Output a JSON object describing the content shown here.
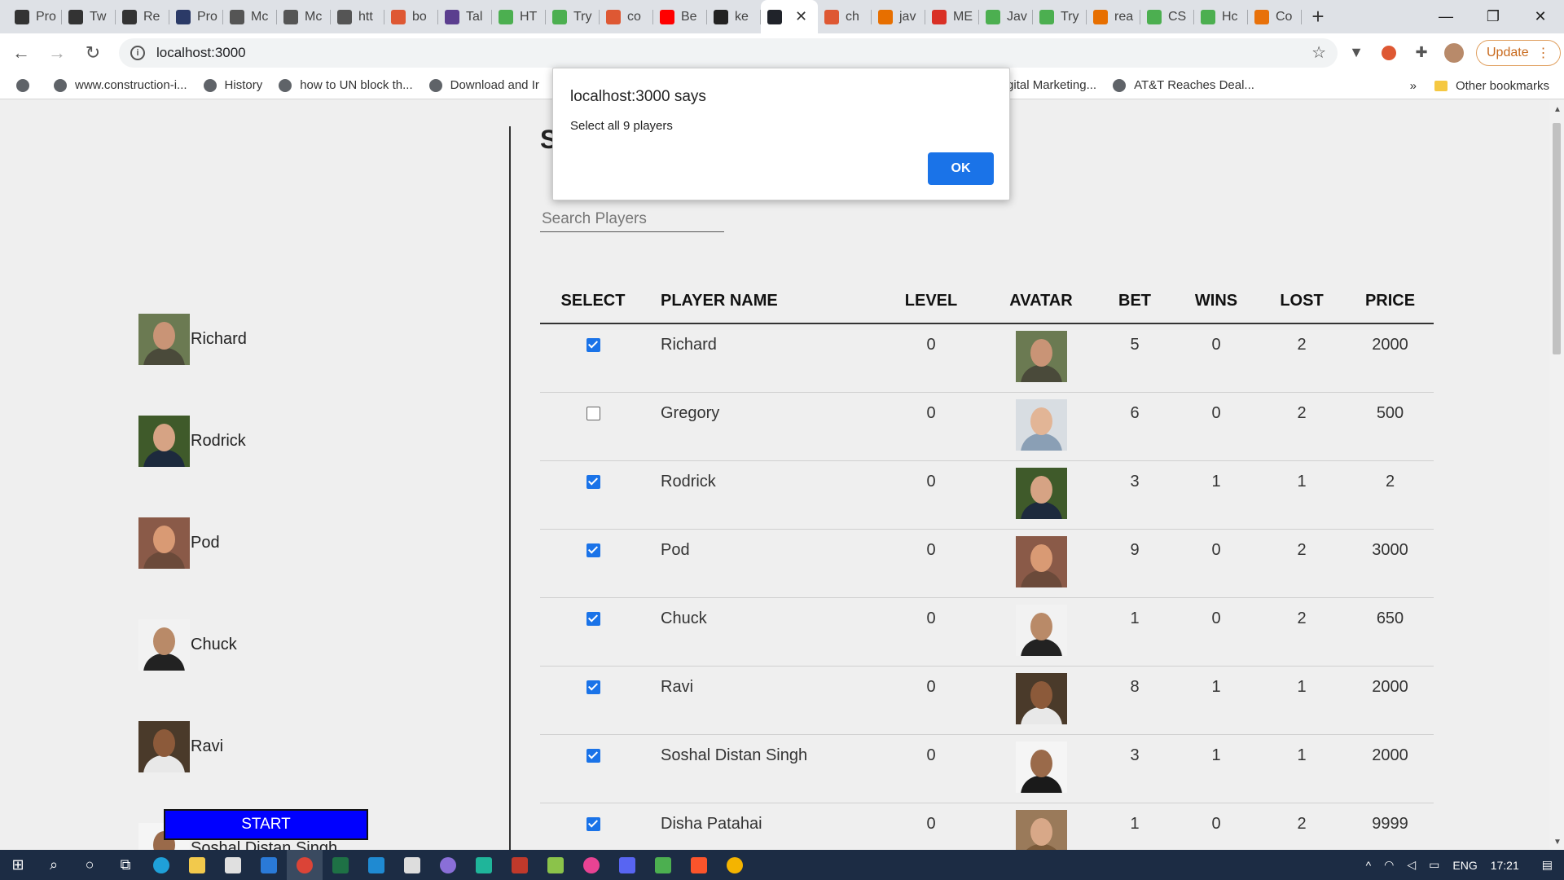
{
  "browser": {
    "tabs": [
      {
        "label": "Pro",
        "icon": "moon-icon",
        "color": "#333333"
      },
      {
        "label": "Tw",
        "icon": "moon-icon",
        "color": "#333333"
      },
      {
        "label": "Re",
        "icon": "moon-icon",
        "color": "#333333"
      },
      {
        "label": "Pro",
        "icon": "h-icon",
        "color": "#2b3a67"
      },
      {
        "label": "Mc",
        "icon": "github-icon",
        "color": "#555555"
      },
      {
        "label": "Mc",
        "icon": "github-icon",
        "color": "#555555"
      },
      {
        "label": "htt",
        "icon": "github-icon",
        "color": "#555555"
      },
      {
        "label": "bo",
        "icon": "duckduckgo-icon",
        "color": "#de5833"
      },
      {
        "label": "Tal",
        "icon": "b-icon",
        "color": "#5b3e8f"
      },
      {
        "label": "HT",
        "icon": "w3-icon",
        "color": "#4caf50"
      },
      {
        "label": "Try",
        "icon": "w3-icon",
        "color": "#4caf50"
      },
      {
        "label": "co",
        "icon": "duckduckgo-icon",
        "color": "#de5833"
      },
      {
        "label": "Be",
        "icon": "youtube-icon",
        "color": "#ff0000"
      },
      {
        "label": "ke",
        "icon": "github-icon",
        "color": "#222222"
      },
      {
        "label": "",
        "icon": "react-icon",
        "color": "#20232a",
        "active": true
      },
      {
        "label": "ch",
        "icon": "duckduckgo-icon",
        "color": "#de5833"
      },
      {
        "label": "jav",
        "icon": "java-icon",
        "color": "#e76f00"
      },
      {
        "label": "ME",
        "icon": "gmail-icon",
        "color": "#d93025"
      },
      {
        "label": "Jav",
        "icon": "w3-icon",
        "color": "#4caf50"
      },
      {
        "label": "Try",
        "icon": "w3-icon",
        "color": "#4caf50"
      },
      {
        "label": "rea",
        "icon": "java-icon",
        "color": "#e76f00"
      },
      {
        "label": "CS",
        "icon": "w3-icon",
        "color": "#4caf50"
      },
      {
        "label": "Hc",
        "icon": "w3-icon",
        "color": "#4caf50"
      },
      {
        "label": "Co",
        "icon": "rainbow-icon",
        "color": "#e8710a"
      }
    ],
    "url": "localhost:3000",
    "update_label": "Update",
    "bookmarks": [
      {
        "label": "",
        "icon": "globe-icon"
      },
      {
        "label": "www.construction-i...",
        "icon": "globe-icon"
      },
      {
        "label": "History",
        "icon": "history-icon"
      },
      {
        "label": "how to UN block th...",
        "icon": "google-icon"
      },
      {
        "label": "Download and Ir",
        "icon": "s-icon"
      },
      {
        "label": "Digital Marketing...",
        "icon": ""
      },
      {
        "label": "AT&T Reaches Deal...",
        "icon": "wsj-icon"
      }
    ],
    "other_bookmarks": "Other bookmarks",
    "more_bookmarks": "»"
  },
  "dialog": {
    "title": "localhost:3000 says",
    "message": "Select all 9 players",
    "ok_label": "OK"
  },
  "page": {
    "heading": "S",
    "search_placeholder": "Search Players",
    "start_label": "START",
    "selected_players": [
      {
        "name": "Richard"
      },
      {
        "name": "Rodrick"
      },
      {
        "name": "Pod"
      },
      {
        "name": "Chuck"
      },
      {
        "name": "Ravi"
      },
      {
        "name": "Soshal Distan Singh"
      }
    ],
    "table": {
      "headers": [
        "SELECT",
        "PLAYER NAME",
        "LEVEL",
        "AVATAR",
        "BET",
        "WINS",
        "LOST",
        "PRICE"
      ],
      "rows": [
        {
          "selected": true,
          "name": "Richard",
          "level": "0",
          "bet": "5",
          "wins": "0",
          "lost": "2",
          "price": "2000",
          "skin": "#c99476",
          "shirt": "#4a4a3a",
          "bg": "#6b7a52"
        },
        {
          "selected": false,
          "name": "Gregory",
          "level": "0",
          "bet": "6",
          "wins": "0",
          "lost": "2",
          "price": "500",
          "skin": "#e2b596",
          "shirt": "#8a9fb5",
          "bg": "#d8dde2"
        },
        {
          "selected": true,
          "name": "Rodrick",
          "level": "0",
          "bet": "3",
          "wins": "1",
          "lost": "1",
          "price": "2",
          "skin": "#d6a384",
          "shirt": "#1d2a3d",
          "bg": "#3f5a2a"
        },
        {
          "selected": true,
          "name": "Pod",
          "level": "0",
          "bet": "9",
          "wins": "0",
          "lost": "2",
          "price": "3000",
          "skin": "#d99a74",
          "shirt": "#6b4a3a",
          "bg": "#8a5a48"
        },
        {
          "selected": true,
          "name": "Chuck",
          "level": "0",
          "bet": "1",
          "wins": "0",
          "lost": "2",
          "price": "650",
          "skin": "#b98a68",
          "shirt": "#222222",
          "bg": "#f2f2f2"
        },
        {
          "selected": true,
          "name": "Ravi",
          "level": "0",
          "bet": "8",
          "wins": "1",
          "lost": "1",
          "price": "2000",
          "skin": "#8c5a3a",
          "shirt": "#e8e8e8",
          "bg": "#4a3a2a"
        },
        {
          "selected": true,
          "name": "Soshal Distan Singh",
          "level": "0",
          "bet": "3",
          "wins": "1",
          "lost": "1",
          "price": "2000",
          "skin": "#9a6a4a",
          "shirt": "#1a1a1a",
          "bg": "#f5f5f5"
        },
        {
          "selected": true,
          "name": "Disha Patahai",
          "level": "0",
          "bet": "1",
          "wins": "0",
          "lost": "2",
          "price": "9999",
          "skin": "#d8a888",
          "shirt": "#7a5a3a",
          "bg": "#9a7a5a"
        }
      ]
    }
  },
  "taskbar": {
    "language": "ENG",
    "time": "17:21"
  }
}
